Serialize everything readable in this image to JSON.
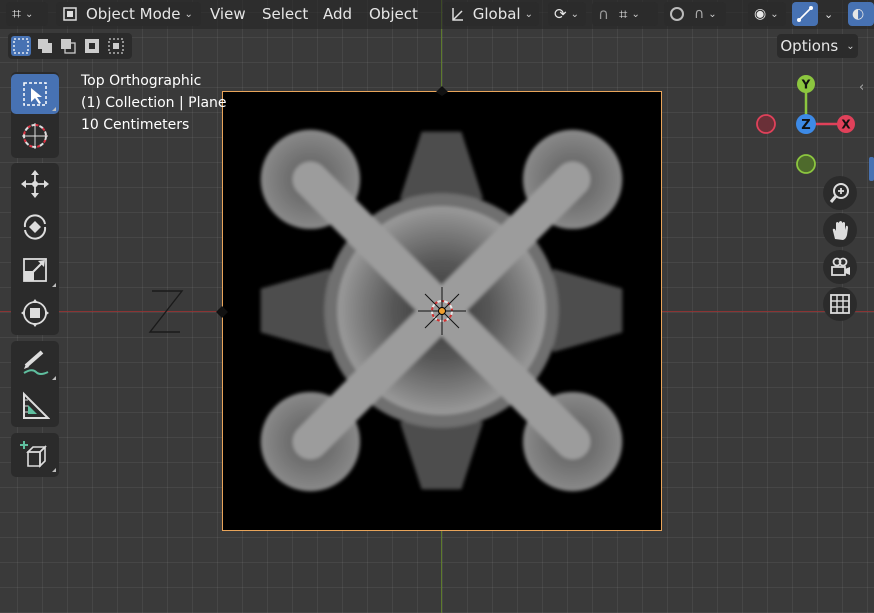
{
  "header": {
    "mode_label": "Object Mode",
    "menus": [
      "View",
      "Select",
      "Add",
      "Object"
    ],
    "orientation_label": "Global"
  },
  "tool_options": {
    "options_label": "Options"
  },
  "overlay": {
    "view_name": "Top Orthographic",
    "collection_info": "(1) Collection | Plane",
    "scale_info": "10 Centimeters"
  },
  "gizmo": {
    "y_label": "Y",
    "z_label": "Z",
    "x_label": "X"
  },
  "colors": {
    "accent": "#4772b3",
    "x_axis": "#e0415a",
    "y_axis": "#8cc63f",
    "z_axis": "#3d8ae6",
    "selection_outline": "#e8a45a"
  }
}
